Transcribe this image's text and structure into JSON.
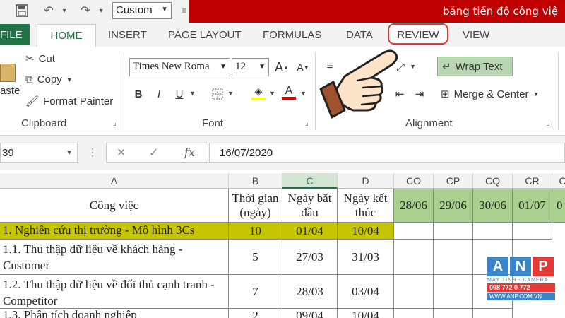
{
  "title_bar": {
    "document_title": "bảng tiến độ công việ",
    "quick_access_style": "Custom"
  },
  "tabs": [
    {
      "id": "file",
      "label": "FILE"
    },
    {
      "id": "home",
      "label": "HOME"
    },
    {
      "id": "insert",
      "label": "INSERT"
    },
    {
      "id": "page_layout",
      "label": "PAGE LAYOUT"
    },
    {
      "id": "formulas",
      "label": "FORMULAS"
    },
    {
      "id": "data",
      "label": "DATA"
    },
    {
      "id": "review",
      "label": "REVIEW"
    },
    {
      "id": "view",
      "label": "VIEW"
    }
  ],
  "ribbon": {
    "clipboard": {
      "paste": "aste",
      "cut": "Cut",
      "copy": "Copy",
      "format_painter": "Format Painter",
      "label": "Clipboard"
    },
    "font": {
      "name": "Times New Roma",
      "size": "12",
      "bold": "B",
      "italic": "I",
      "underline": "U",
      "label": "Font",
      "grow": "A",
      "shrink": "A",
      "color_letter": "A"
    },
    "alignment": {
      "wrap_text": "Wrap Text",
      "merge_center": "Merge & Center",
      "label": "Alignment"
    }
  },
  "formula_bar": {
    "name_box": "39",
    "fx": "fx",
    "formula": "16/07/2020"
  },
  "grid": {
    "columns": [
      "A",
      "B",
      "C",
      "D",
      "CO",
      "CP",
      "CQ",
      "CR",
      "C"
    ],
    "header_row": {
      "a": "Công việc",
      "b": "Thời gian (ngày)",
      "c": "Ngày bắt đầu",
      "d": "Ngày kết thúc",
      "dates": [
        "28/06",
        "29/06",
        "30/06",
        "01/07",
        "0"
      ]
    },
    "rows": [
      {
        "a": "1. Nghiên cứu thị trường - Mô hình 3Cs",
        "b": "10",
        "c": "01/04",
        "d": "10/04"
      },
      {
        "a": "1.1. Thu thập dữ liệu về khách hàng - Customer",
        "b": "5",
        "c": "27/03",
        "d": "31/03"
      },
      {
        "a": "1.2. Thu thập dữ liệu về đối thủ cạnh tranh - Competitor",
        "b": "7",
        "c": "28/03",
        "d": "03/04"
      },
      {
        "a": "1.3. Phân tích doanh nghiệp",
        "b": "2",
        "c": "09/04",
        "d": "10/04"
      }
    ]
  },
  "watermark": {
    "letters": [
      "A",
      "N",
      "P"
    ],
    "tagline": "MÁY TÍNH - CAMERA",
    "phone": "098 772 0 772",
    "url": "WWW.ANP.COM.VN"
  },
  "colors": {
    "excel_green": "#217346",
    "title_red": "#c00000",
    "date_header_green": "#a9d08e",
    "highlight_yellow": "#c6c600",
    "review_outline": "#e53935"
  }
}
